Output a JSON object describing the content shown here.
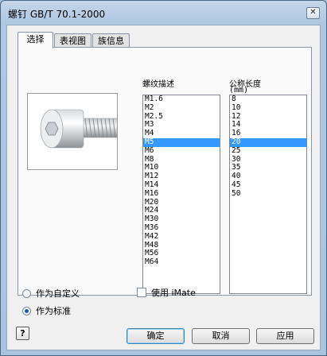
{
  "window": {
    "title": "螺钉 GB/T 70.1-2000",
    "close_glyph": "✕"
  },
  "tabs": [
    {
      "label": "选择",
      "active": true
    },
    {
      "label": "表视图",
      "active": false
    },
    {
      "label": "族信息",
      "active": false
    }
  ],
  "preview": {
    "icon": "socket-head-screw-image"
  },
  "thread_list": {
    "header": "螺纹描述",
    "items": [
      "M1.6",
      "M2",
      "M2.5",
      "M3",
      "M4",
      "M5",
      "M6",
      "M8",
      "M10",
      "M12",
      "M14",
      "M16",
      "M20",
      "M24",
      "M30",
      "M36",
      "M42",
      "M48",
      "M56",
      "M64"
    ],
    "selected": "M5"
  },
  "length_list": {
    "header": "公称长度",
    "unit": "(mm)",
    "items": [
      "8",
      "10",
      "12",
      "14",
      "16",
      "20",
      "25",
      "30",
      "35",
      "40",
      "45",
      "50"
    ],
    "selected": "20"
  },
  "options": {
    "custom_label": "作为自定义",
    "standard_label": "作为标准",
    "selected": "standard",
    "imate_label": "使用 iMate",
    "imate_checked": false
  },
  "buttons": {
    "ok": "确定",
    "cancel": "取消",
    "apply": "应用",
    "help": "?"
  },
  "colors": {
    "selection": "#3399ff",
    "title_bar": "#c3d6ea"
  }
}
